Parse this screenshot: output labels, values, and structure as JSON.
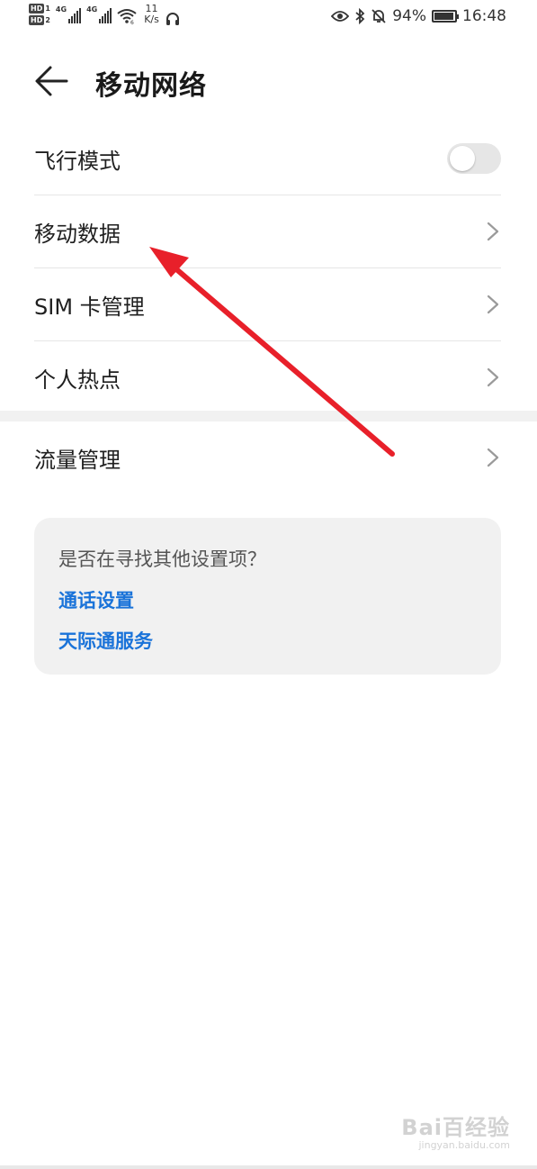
{
  "status_bar": {
    "sim1_label": "HD",
    "sim1_index": "1",
    "sim2_label": "HD",
    "sim2_index": "2",
    "network1": "4G",
    "network2": "4G",
    "speed_value": "11",
    "speed_unit": "K/s",
    "battery_percent": "94%",
    "battery_level": 0.94,
    "time": "16:48",
    "icons": [
      "wifi-icon",
      "headphones-icon",
      "eye-icon",
      "bluetooth-icon",
      "mute-bell-icon",
      "battery-icon"
    ]
  },
  "header": {
    "title": "移动网络"
  },
  "settings": {
    "airplane_mode": {
      "label": "飞行模式",
      "enabled": false
    },
    "mobile_data": {
      "label": "移动数据"
    },
    "sim_management": {
      "label": "SIM 卡管理"
    },
    "hotspot": {
      "label": "个人热点"
    },
    "data_usage": {
      "label": "流量管理"
    }
  },
  "suggestions": {
    "question": "是否在寻找其他设置项？",
    "links": [
      "通话设置",
      "天际通服务"
    ]
  },
  "colors": {
    "link": "#1a73d9",
    "annotation_arrow": "#e8202a",
    "card_bg": "#f1f1f1"
  },
  "watermark": {
    "brand": "Bai百经验",
    "url": "jingyan.baidu.com"
  }
}
